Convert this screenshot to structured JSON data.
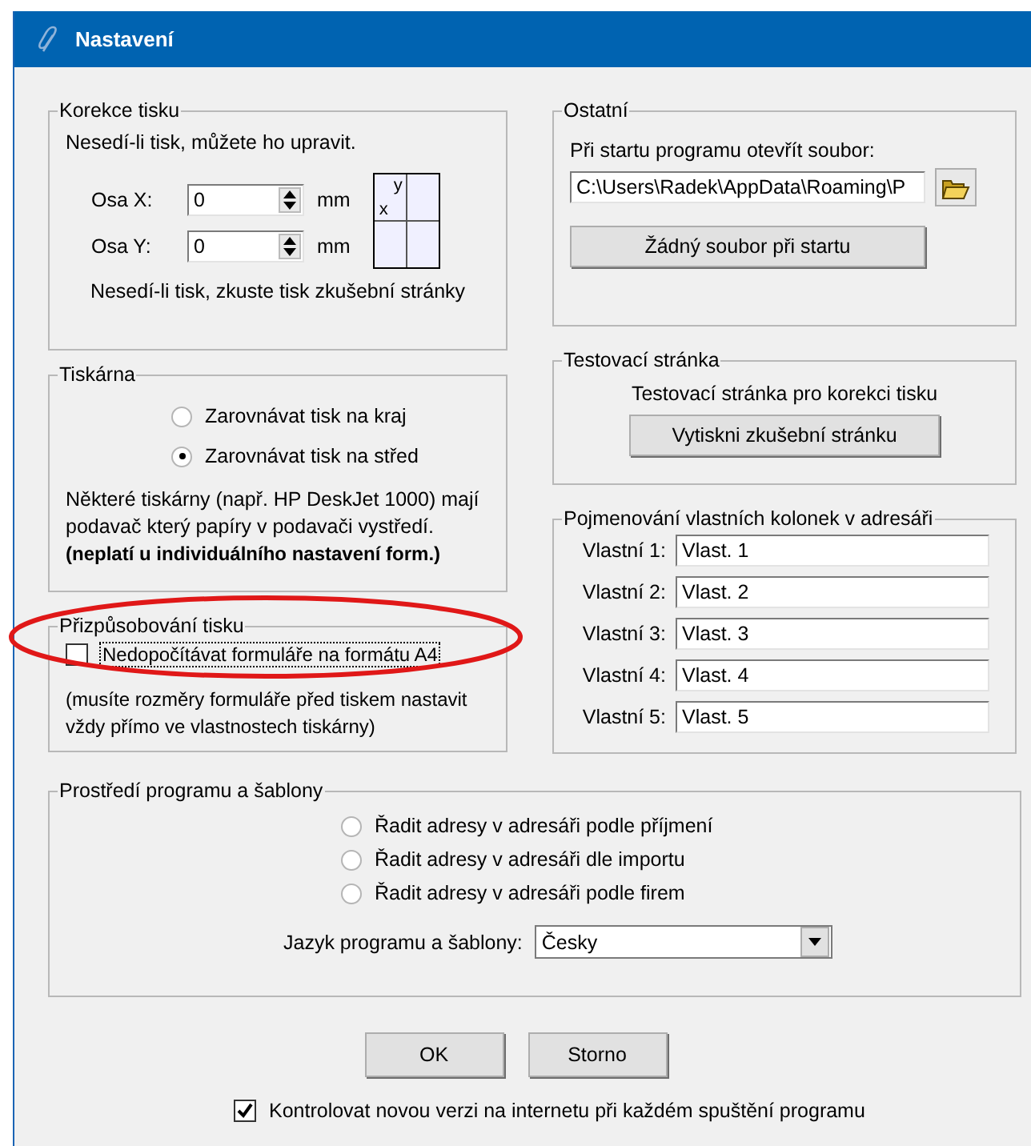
{
  "window": {
    "title": "Nastavení"
  },
  "print_correction": {
    "title": "Korekce tisku",
    "hint": "Nesedí-li tisk, můžete ho upravit.",
    "axes": [
      {
        "label": "Osa X:",
        "value": "0",
        "unit": "mm"
      },
      {
        "label": "Osa Y:",
        "value": "0",
        "unit": "mm"
      }
    ],
    "preview": {
      "y_label": "y",
      "x_label": "x"
    },
    "footer": "Nesedí-li tisk, zkuste tisk zkušební stránky"
  },
  "printer": {
    "title": "Tiskárna",
    "options": [
      {
        "label": "Zarovnávat tisk na kraj",
        "selected": false
      },
      {
        "label": "Zarovnávat tisk na střed",
        "selected": true
      }
    ],
    "note": "Některé tiskárny (např. HP DeskJet 1000) mají podavač který papíry v podavači vystředí.",
    "note_bold": "(neplatí u individuálního nastavení form.)"
  },
  "print_fitting": {
    "title": "Přizpůsobování tisku",
    "option": {
      "label": "Nedopočítávat formuláře na formátu A4",
      "checked": false,
      "focused": true
    },
    "note": "(musíte rozměry formuláře před tiskem nastavit vždy přímo ve vlastnostech tiskárny)"
  },
  "other": {
    "title": "Ostatní",
    "label": "Při startu programu otevřít soubor:",
    "path": "C:\\Users\\Radek\\AppData\\Roaming\\P",
    "button": "Žádný soubor při startu"
  },
  "test_page": {
    "title": "Testovací stránka",
    "text": "Testovací stránka pro korekci tisku",
    "button": "Vytiskni zkušební stránku"
  },
  "custom_columns": {
    "title": "Pojmenování vlastních kolonek v adresáři",
    "rows": [
      {
        "label": "Vlastní 1:",
        "value": "Vlast. 1"
      },
      {
        "label": "Vlastní 2:",
        "value": "Vlast. 2"
      },
      {
        "label": "Vlastní 3:",
        "value": "Vlast. 3"
      },
      {
        "label": "Vlastní 4:",
        "value": "Vlast. 4"
      },
      {
        "label": "Vlastní 5:",
        "value": "Vlast. 5"
      }
    ]
  },
  "environment": {
    "title": "Prostředí programu a šablony",
    "sort_options": [
      {
        "label": "Řadit adresy v adresáři podle příjmení",
        "selected": false
      },
      {
        "label": "Řadit adresy v adresáři dle importu",
        "selected": false
      },
      {
        "label": "Řadit adresy v adresáři podle firem",
        "selected": false
      }
    ],
    "language": {
      "label": "Jazyk programu a šablony:",
      "value": "Česky"
    }
  },
  "buttons": [
    "OK",
    "Storno"
  ],
  "update_check": {
    "label": "Kontrolovat novou verzi na internetu při každém spuštění programu",
    "checked": true
  },
  "annotation": {
    "shown": true
  }
}
